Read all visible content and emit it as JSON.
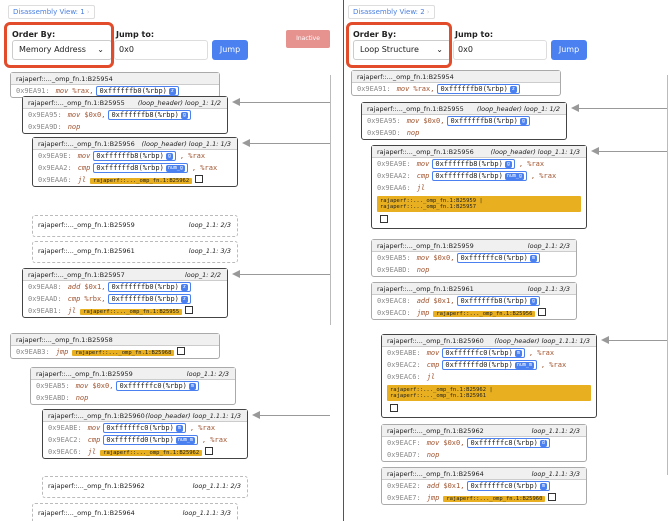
{
  "panel1": {
    "tab_label": "Disassembly View: 1",
    "order_by_label": "Order By:",
    "order_by_value": "Memory Address",
    "jump_label": "Jump to:",
    "jump_value": "0x0",
    "jump_button": "Jump",
    "inactive_button": "Inactive",
    "blocks": [
      {
        "fn": "rajaperf::..._omp_fn.1:B25954",
        "tag": "",
        "ins": [
          {
            "addr": "0x9EA91:",
            "op": "mov",
            "reg": "%rax,",
            "mem": "0xffffffb0(%rbp)",
            "badge": "z"
          }
        ]
      },
      {
        "fn": "rajaperf::..._omp_fn.1:B25955",
        "tag": "(loop_header) loop_1: 1/2",
        "ins": [
          {
            "addr": "0x9EA95:",
            "op": "mov",
            "reg": "$0x0,",
            "mem": "0xffffffb8(%rbp)",
            "badge": "g"
          },
          {
            "addr": "0x9EA9D:",
            "op": "nop"
          }
        ]
      },
      {
        "fn": "rajaperf::..._omp_fn.1:B25956",
        "tag": "(loop_header) loop_1.1: 1/3",
        "ins": [
          {
            "addr": "0x9EA9E:",
            "op": "mov",
            "mem": "0xffffffb8(%rbp)",
            "badge": "g",
            "reg2": ", %rax"
          },
          {
            "addr": "0x9EAA2:",
            "op": "cmp",
            "mem": "0xffffffd8(%rbp)",
            "badge": "num_g",
            "reg2": ", %rax"
          },
          {
            "addr": "0x9EAA6:",
            "op": "jl",
            "tgt": "rajaperf::..._omp_fn.1:B25962"
          }
        ]
      },
      {
        "fn": "rajaperf::..._omp_fn.1:B25959",
        "tag": "loop_1.1: 2/3"
      },
      {
        "fn": "rajaperf::..._omp_fn.1:B25961",
        "tag": "loop_1.1: 3/3"
      },
      {
        "fn": "rajaperf::..._omp_fn.1:B25957",
        "tag": "loop_1: 2/2",
        "ins": [
          {
            "addr": "0x9EAA8:",
            "op": "add",
            "reg": "$0x1,",
            "mem": "0xffffffb0(%rbp)",
            "badge": "z"
          },
          {
            "addr": "0x9EAAD:",
            "op": "cmp",
            "reg": "%rbx,",
            "mem": "0xffffffb0(%rbp)",
            "badge": "z"
          },
          {
            "addr": "0x9EAB1:",
            "op": "jl",
            "tgt": "rajaperf::..._omp_fn.1:B25955"
          }
        ]
      },
      {
        "fn": "rajaperf::..._omp_fn.1:B25958",
        "tag": "",
        "ins": [
          {
            "addr": "0x9EAB3:",
            "op": "jmp",
            "tgt": "rajaperf::..._omp_fn.1:B25968"
          }
        ]
      },
      {
        "fn": "rajaperf::..._omp_fn.1:B25959",
        "tag": "loop_1.1: 2/3",
        "ins": [
          {
            "addr": "0x9EAB5:",
            "op": "mov",
            "reg": "$0x0,",
            "mem": "0xffffffc0(%rbp)",
            "badge": "m"
          },
          {
            "addr": "0x9EABD:",
            "op": "nop"
          }
        ]
      },
      {
        "fn": "rajaperf::..._omp_fn.1:B25960",
        "tag": "(loop_header) loop_1.1.1: 1/3",
        "ins": [
          {
            "addr": "0x9EABE:",
            "op": "mov",
            "mem": "0xffffffc0(%rbp)",
            "badge": "m",
            "reg2": ", %rax"
          },
          {
            "addr": "0x9EAC2:",
            "op": "cmp",
            "mem": "0xffffffd0(%rbp)",
            "badge": "num_m",
            "reg2": ", %rax"
          },
          {
            "addr": "0x9EAC6:",
            "op": "jl",
            "tgt": "rajaperf::..._omp_fn.1:B25962"
          }
        ]
      },
      {
        "fn": "rajaperf::..._omp_fn.1:B25962",
        "tag": "loop_1.1.1: 2/3"
      },
      {
        "fn": "rajaperf::..._omp_fn.1:B25964",
        "tag": "loop_1.1.1: 3/3"
      }
    ]
  },
  "panel2": {
    "tab_label": "Disassembly View: 2",
    "order_by_label": "Order By:",
    "order_by_value": "Loop Structure",
    "jump_label": "Jump to:",
    "jump_value": "0x0",
    "jump_button": "Jump",
    "blocks": [
      {
        "fn": "rajaperf::..._omp_fn.1:B25954",
        "tag": "",
        "ins": [
          {
            "addr": "0x9EA91:",
            "op": "mov",
            "reg": "%rax,",
            "mem": "0xffffffb0(%rbp)",
            "badge": "z"
          }
        ]
      },
      {
        "fn": "rajaperf::..._omp_fn.1:B25955",
        "tag": "(loop_header) loop_1: 1/2",
        "ins": [
          {
            "addr": "0x9EA95:",
            "op": "mov",
            "reg": "$0x0,",
            "mem": "0xffffffb8(%rbp)",
            "badge": "g"
          },
          {
            "addr": "0x9EA9D:",
            "op": "nop"
          }
        ]
      },
      {
        "fn": "rajaperf::..._omp_fn.1:B25956",
        "tag": "(loop_header) loop_1.1: 1/3",
        "ins": [
          {
            "addr": "0x9EA9E:",
            "op": "mov",
            "mem": "0xffffffb8(%rbp)",
            "badge": "g",
            "reg2": ", %rax"
          },
          {
            "addr": "0x9EAA2:",
            "op": "cmp",
            "mem": "0xffffffd8(%rbp)",
            "badge": "num_g",
            "reg2": ", %rax"
          },
          {
            "addr": "0x9EAA6:",
            "op": "jl"
          }
        ],
        "multi": [
          "rajaperf::..._omp_fn.1:B25959 |",
          "rajaperf::..._omp_fn.1:B25957"
        ]
      },
      {
        "fn": "rajaperf::..._omp_fn.1:B25959",
        "tag": "loop_1.1: 2/3",
        "ins": [
          {
            "addr": "0x9EAB5:",
            "op": "mov",
            "reg": "$0x0,",
            "mem": "0xffffffc0(%rbp)",
            "badge": "m"
          },
          {
            "addr": "0x9EABD:",
            "op": "nop"
          }
        ]
      },
      {
        "fn": "rajaperf::..._omp_fn.1:B25961",
        "tag": "loop_1.1: 3/3",
        "ins": [
          {
            "addr": "0x9EAC8:",
            "op": "add",
            "reg": "$0x1,",
            "mem": "0xffffffb8(%rbp)",
            "badge": "g"
          },
          {
            "addr": "0x9EACD:",
            "op": "jmp",
            "tgt": "rajaperf::..._omp_fn.1:B25956"
          }
        ]
      },
      {
        "fn": "rajaperf::..._omp_fn.1:B25960",
        "tag": "(loop_header) loop_1.1.1: 1/3",
        "ins": [
          {
            "addr": "0x9EABE:",
            "op": "mov",
            "mem": "0xffffffc0(%rbp)",
            "badge": "m",
            "reg2": ", %rax"
          },
          {
            "addr": "0x9EAC2:",
            "op": "cmp",
            "mem": "0xffffffd0(%rbp)",
            "badge": "num_m",
            "reg2": ", %rax"
          },
          {
            "addr": "0x9EAC6:",
            "op": "jl"
          }
        ],
        "multi": [
          "rajaperf::..._omp_fn.1:B25962 |",
          "rajaperf::..._omp_fn.1:B25961"
        ]
      },
      {
        "fn": "rajaperf::..._omp_fn.1:B25962",
        "tag": "loop_1.1.1: 2/3",
        "ins": [
          {
            "addr": "0x9EACF:",
            "op": "mov",
            "reg": "$0x0,",
            "mem": "0xffffffc8(%rbp)",
            "badge": "d"
          },
          {
            "addr": "0x9EAD7:",
            "op": "nop"
          }
        ]
      },
      {
        "fn": "rajaperf::..._omp_fn.1:B25964",
        "tag": "loop_1.1.1: 3/3",
        "ins": [
          {
            "addr": "0x9EAE2:",
            "op": "add",
            "reg": "$0x1,",
            "mem": "0xffffffc0(%rbp)",
            "badge": "m"
          },
          {
            "addr": "0x9EAE7:",
            "op": "jmp",
            "tgt": "rajaperf::..._omp_fn.1:B25960"
          }
        ]
      }
    ]
  },
  "colors": {
    "accent": "#4a80f0",
    "highlight": "#e24c2a",
    "target": "#e8b020",
    "inactive": "#e6928f"
  }
}
